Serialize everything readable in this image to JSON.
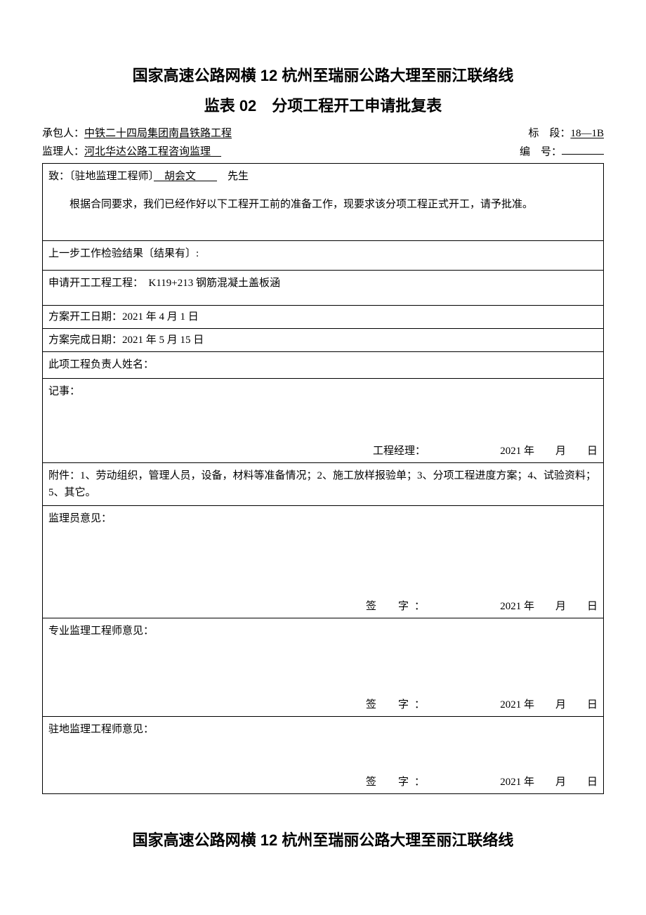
{
  "title_main": "国家高速公路网横 12 杭州至瑞丽公路大理至丽江联络线",
  "title_sub": "监表 02　分项工程开工申请批复表",
  "header": {
    "contractor_label": "承包人：",
    "contractor_value": "中铁二十四局集团南昌铁路工程",
    "section_label": "标　段：",
    "section_value": "18—1B",
    "supervisor_label": "监理人：",
    "supervisor_value": "河北华达公路工程咨询监理　",
    "serial_label": "编　号：",
    "serial_value": ""
  },
  "body": {
    "addressee_prefix": "致：〔驻地监理工程师〕",
    "addressee_name": "　胡会文　　",
    "addressee_suffix": "　先生",
    "paragraph": "根据合同要求，我们已经作好以下工程开工前的准备工作，现要求该分项工程正式开工，请予批准。",
    "prev_check_label": "上一步工作检验结果〔结果有〕:",
    "apply_label": "申请开工工程工程：",
    "apply_value": "　K119+213 钢筋混凝土盖板涵",
    "plan_start_label": "方案开工日期：",
    "plan_start_value": "2021 年 4 月 1 日",
    "plan_end_label": "方案完成日期：",
    "plan_end_value": "2021 年 5 月 15 日",
    "responsible_label": "此项工程负责人姓名：",
    "notes_label": "记事：",
    "pm_sig_label": "工程经理：",
    "date_template": "2021 年　　月　　日",
    "attachments": "附件：1、劳动组织，管理人员，设备，材料等准备情况；2、施工放样报验单；3、分项工程进度方案；4、试验资料；5、其它。",
    "opinion_inspector": "监理员意见：",
    "opinion_pro_engineer": "专业监理工程师意见：",
    "opinion_resident_engineer": "驻地监理工程师意见：",
    "sign_label": "签　字："
  },
  "footer_title": "国家高速公路网横 12 杭州至瑞丽公路大理至丽江联络线"
}
